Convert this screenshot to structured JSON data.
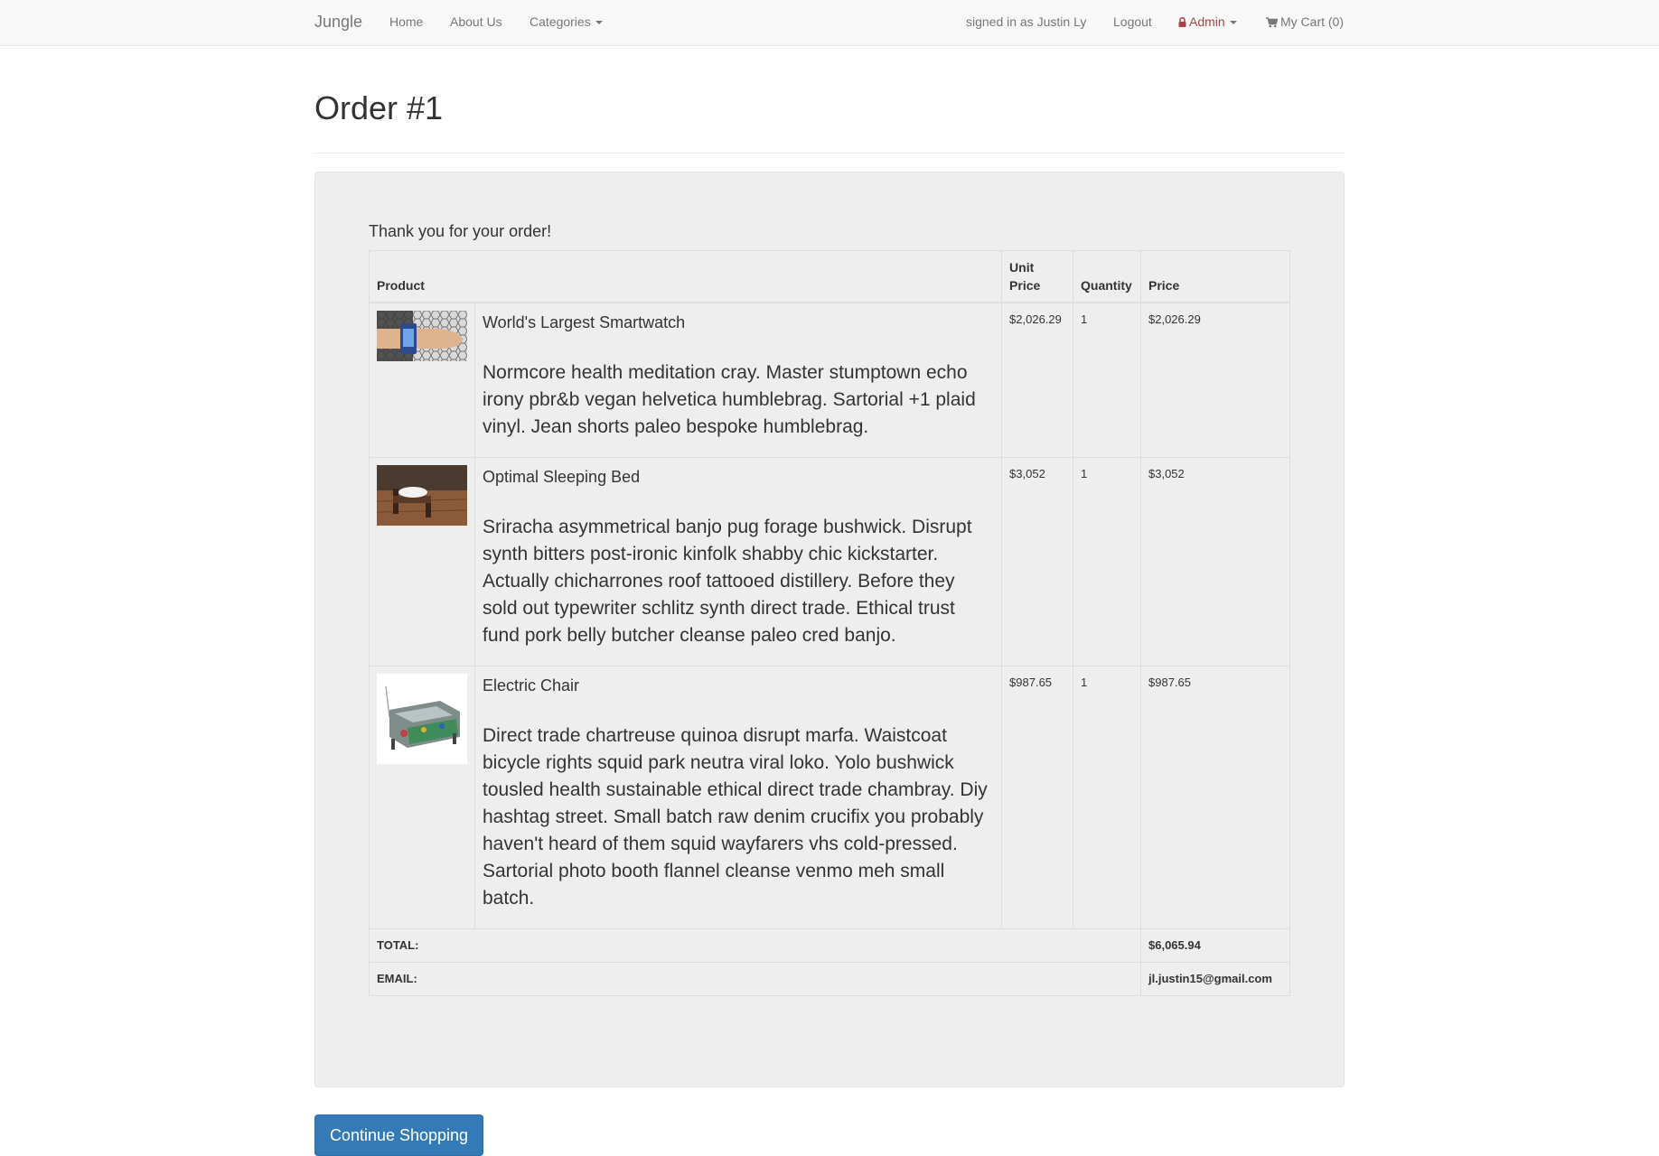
{
  "navbar": {
    "brand": "Jungle",
    "links": [
      {
        "label": "Home"
      },
      {
        "label": "About Us"
      },
      {
        "label": "Categories"
      }
    ],
    "signed_in": "signed in as Justin Ly",
    "logout": "Logout",
    "admin": "Admin",
    "cart": "My Cart (0)"
  },
  "page": {
    "title": "Order #1",
    "thanks": "Thank you for your order!"
  },
  "table": {
    "headers": {
      "product": "Product",
      "unit_price": "Unit Price",
      "quantity": "Quantity",
      "price": "Price"
    },
    "rows": [
      {
        "name": "World's Largest Smartwatch",
        "description": "Normcore health meditation cray. Master stumptown echo irony pbr&b vegan helvetica humblebrag. Sartorial +1 plaid vinyl. Jean shorts paleo bespoke humblebrag.",
        "unit_price": "$2,026.29",
        "quantity": "1",
        "price": "$2,026.29"
      },
      {
        "name": "Optimal Sleeping Bed",
        "description": "Sriracha asymmetrical banjo pug forage bushwick. Disrupt synth bitters post-ironic kinfolk shabby chic kickstarter. Actually chicharrones roof tattooed distillery. Before they sold out typewriter schlitz synth direct trade. Ethical trust fund pork belly butcher cleanse paleo cred banjo.",
        "unit_price": "$3,052",
        "quantity": "1",
        "price": "$3,052"
      },
      {
        "name": "Electric Chair",
        "description": "Direct trade chartreuse quinoa disrupt marfa. Waistcoat bicycle rights squid park neutra viral loko. Yolo bushwick tousled health sustainable ethical direct trade chambray. Diy hashtag street. Small batch raw denim crucifix you probably haven't heard of them squid wayfarers vhs cold-pressed. Sartorial photo booth flannel cleanse venmo meh small batch.",
        "unit_price": "$987.65",
        "quantity": "1",
        "price": "$987.65"
      }
    ],
    "total_label": "TOTAL:",
    "total_value": "$6,065.94",
    "email_label": "EMAIL:",
    "email_value": "jl.justin15@gmail.com"
  },
  "actions": {
    "continue": "Continue Shopping"
  },
  "colors": {
    "navbar_bg": "#f8f8f8",
    "well_bg": "#eeeeee",
    "admin": "#a94442",
    "primary_button": "#337ab7"
  }
}
